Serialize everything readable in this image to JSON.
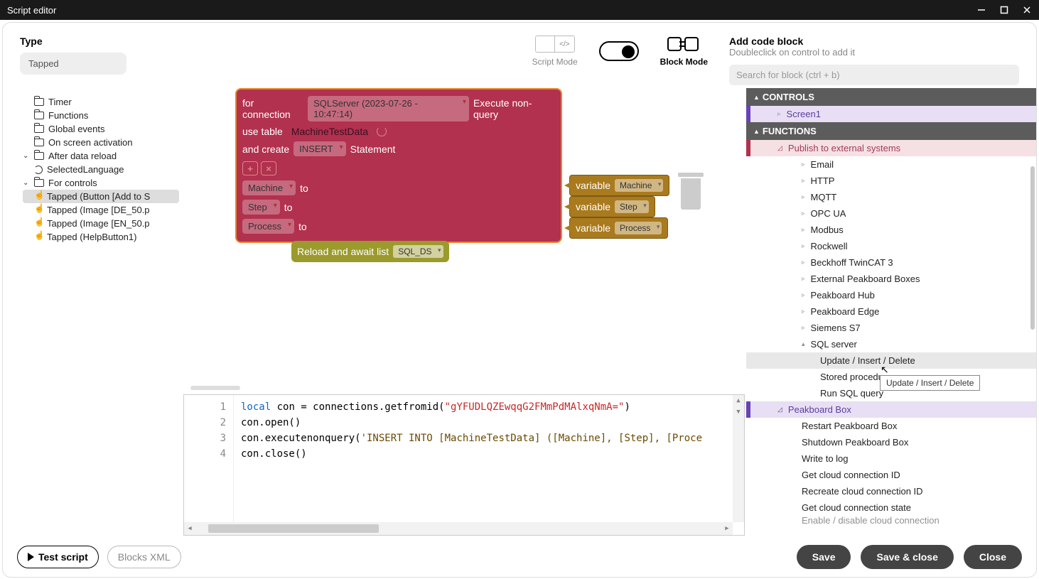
{
  "titlebar": {
    "title": "Script editor"
  },
  "type": {
    "label": "Type",
    "value": "Tapped"
  },
  "modes": {
    "script": "Script Mode",
    "block": "Block Mode"
  },
  "rightHead": {
    "title": "Add code block",
    "subtitle": "Doubleclick on control to add it",
    "searchPlaceholder": "Search for block (ctrl + b)"
  },
  "tree": {
    "items": [
      {
        "label": "Timer",
        "icon": "folder",
        "indent": 0
      },
      {
        "label": "Functions",
        "icon": "folder",
        "indent": 0
      },
      {
        "label": "Global events",
        "icon": "folder",
        "indent": 0
      },
      {
        "label": "On screen activation",
        "icon": "folder",
        "indent": 0
      },
      {
        "label": "After data reload",
        "icon": "folder",
        "indent": 0,
        "chev": "down"
      },
      {
        "label": "SelectedLanguage",
        "icon": "loop",
        "indent": 1
      },
      {
        "label": "For controls",
        "icon": "folder",
        "indent": 0,
        "chev": "down"
      },
      {
        "label": "Tapped (Button [Add to S",
        "icon": "hand",
        "indent": 1,
        "sel": true
      },
      {
        "label": "Tapped (Image [DE_50.p",
        "icon": "hand",
        "indent": 1
      },
      {
        "label": "Tapped (Image [EN_50.p",
        "icon": "hand",
        "indent": 1
      },
      {
        "label": "Tapped (HelpButton1)",
        "icon": "hand",
        "indent": 1
      }
    ]
  },
  "blocks": {
    "forConn": "for connection",
    "connChip": "SQLServer (2023-07-26 - 10:47:14)",
    "execNon": "Execute non-query",
    "useTable": "use table",
    "tableName": "MachineTestData",
    "andCreate": "and create",
    "insertChip": "INSERT",
    "statement": "Statement",
    "rows": [
      {
        "field": "Machine",
        "to": "to",
        "var": "variable",
        "val": "Machine"
      },
      {
        "field": "Step",
        "to": "to",
        "var": "variable",
        "val": "Step"
      },
      {
        "field": "Process",
        "to": "to",
        "var": "variable",
        "val": "Process"
      }
    ],
    "reload": "Reload and await list",
    "reloadChip": "SQL_DS"
  },
  "code": {
    "lines": [
      {
        "n": "1",
        "pre": "",
        "kw": "local",
        "rest": " con = connections.getfromid(",
        "str": "\"gYFUDLQZEwqqG2FMmPdMAlxqNmA=\"",
        "tail": ")"
      },
      {
        "n": "2",
        "text": "con.open()"
      },
      {
        "n": "3",
        "pre": "con.executenonquery(",
        "str": "'INSERT INTO [MachineTestData] ([Machine], [Step], [Proce"
      },
      {
        "n": "4",
        "text": "con.close()"
      }
    ]
  },
  "palette": {
    "controlsHeader": "CONTROLS",
    "screen1": "Screen1",
    "functionsHeader": "FUNCTIONS",
    "publish": "Publish to external systems",
    "items": [
      "Email",
      "HTTP",
      "MQTT",
      "OPC UA",
      "Modbus",
      "Rockwell",
      "Beckhoff TwinCAT 3",
      "External Peakboard Boxes",
      "Peakboard Hub",
      "Peakboard Edge",
      "Siemens S7",
      "SQL server"
    ],
    "sqlChildren": [
      "Update / Insert / Delete",
      "Stored procedure",
      "Run SQL query"
    ],
    "peakboardBox": "Peakboard Box",
    "pbItems": [
      "Restart Peakboard Box",
      "Shutdown Peakboard Box",
      "Write to log",
      "Get cloud connection ID",
      "Recreate cloud connection ID",
      "Get cloud connection state",
      "Enable / disable cloud connection"
    ]
  },
  "tooltip": "Update / Insert / Delete",
  "footer": {
    "test": "Test script",
    "blocksXml": "Blocks XML",
    "save": "Save",
    "saveClose": "Save & close",
    "close": "Close"
  }
}
